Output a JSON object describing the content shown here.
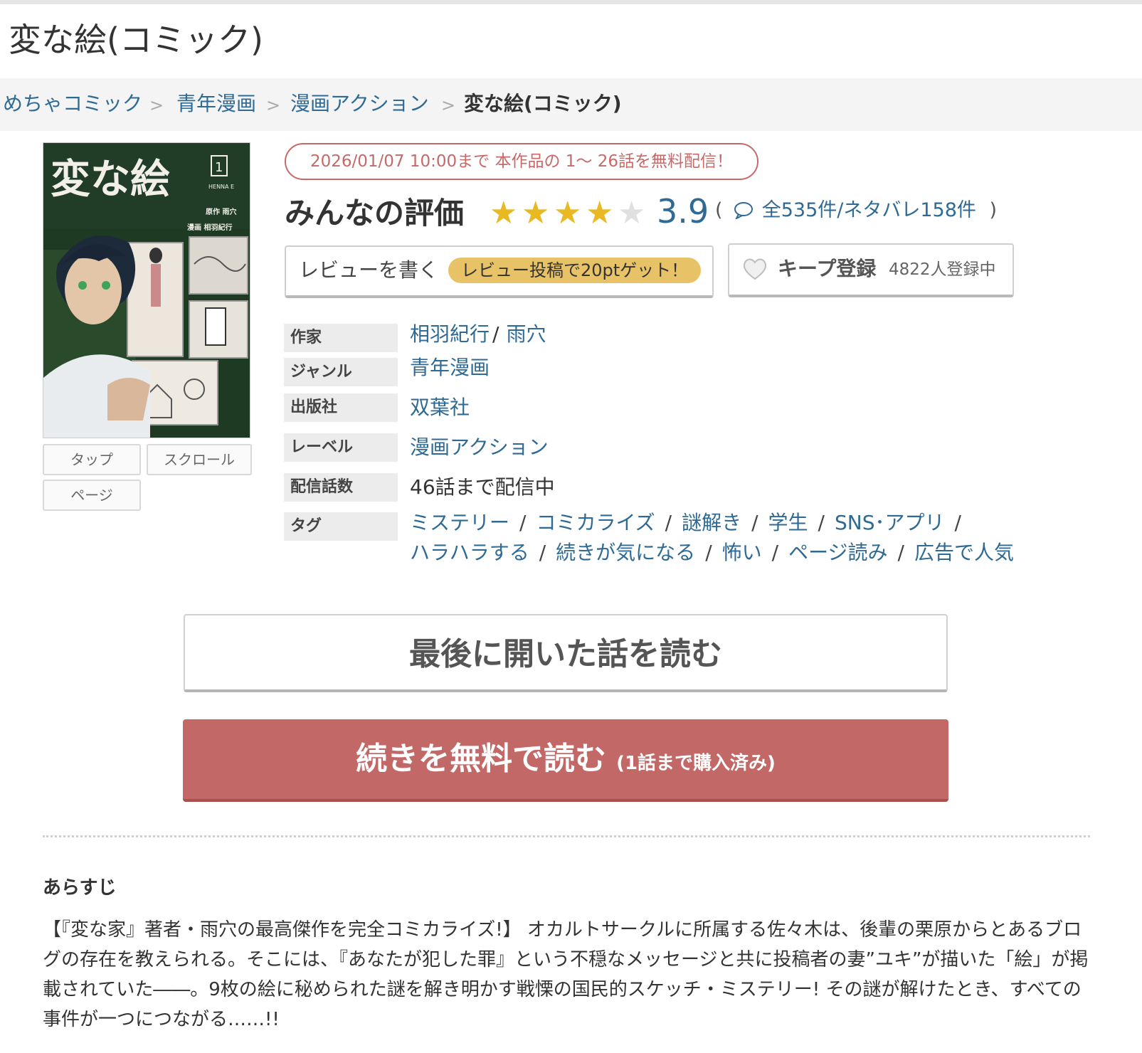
{
  "page": {
    "title": "変な絵(コミック)"
  },
  "breadcrumb": {
    "items": [
      "めちゃコミック",
      "青年漫画",
      "漫画アクション"
    ],
    "current": "変な絵(コミック)",
    "separator": ">"
  },
  "cover": {
    "title_text": "変な絵",
    "volume": "1",
    "subtitle": "HENNA E",
    "credit_1": "原作 雨穴",
    "credit_2": "漫画 相羽紀行"
  },
  "view_modes": [
    "タップ",
    "スクロール",
    "ページ"
  ],
  "free_campaign": "2026/01/07 10:00まで 本作品の 1～ 26話を無料配信！",
  "rating": {
    "label": "みんなの評価",
    "score": "3.9",
    "stars_filled": 4,
    "stars_total": 5,
    "open_paren": "(",
    "close_paren": ")",
    "review_count": "全535件/ネタバレ158件"
  },
  "actions": {
    "write_review": "レビューを書く",
    "write_review_bonus": "レビュー投稿で20ptゲット！",
    "keep": "キープ登録",
    "keep_count": "4822人登録中"
  },
  "info": {
    "author_label": "作家",
    "authors": [
      "相羽紀行",
      "雨穴"
    ],
    "genre_label": "ジャンル",
    "genre": "青年漫画",
    "publisher_label": "出版社",
    "publisher": "双葉社",
    "label_label": "レーベル",
    "label": "漫画アクション",
    "episodes_label": "配信話数",
    "episodes": "46話まで配信中",
    "tags_label": "タグ",
    "tags_line1": [
      "ミステリー",
      "コミカライズ",
      "謎解き",
      "学生",
      "SNS･アプリ"
    ],
    "tags_line2": [
      "ハラハラする",
      "続きが気になる",
      "怖い",
      "ページ読み",
      "広告で人気"
    ]
  },
  "buttons": {
    "last_read": "最後に開いた話を読む",
    "continue_free": "続きを無料で読む",
    "continue_note": "(1話まで購入済み)"
  },
  "synopsis": {
    "heading": "あらすじ",
    "body": "【『変な家』著者・雨穴の最高傑作を完全コミカライズ!】 オカルトサークルに所属する佐々木は、後輩の栗原からとあるブログの存在を教えられる。そこには、『あなたが犯した罪』という不穏なメッセージと共に投稿者の妻”ユキ”が描いた「絵」が掲載されていた――。9枚の絵に秘められた謎を解き明かす戦慄の国民的スケッチ・ミステリー! その謎が解けたとき、すべての事件が一つにつながる……!!"
  },
  "colors": {
    "link": "#2f6a94",
    "accent_red": "#c26968",
    "star_gold": "#e8b923",
    "star_empty": "#e0e0e0",
    "pill_yellow": "#e8c267"
  }
}
